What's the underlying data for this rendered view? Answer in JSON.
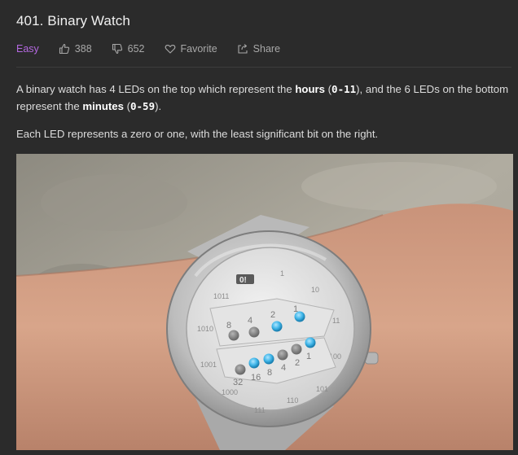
{
  "problem": {
    "title": "401. Binary Watch",
    "difficulty": "Easy",
    "likes": "388",
    "dislikes": "652",
    "favorite_label": "Favorite",
    "share_label": "Share"
  },
  "description": {
    "p1_before_hours": "A binary watch has 4 LEDs on the top which represent the ",
    "hours_word": "hours",
    "hours_open": " (",
    "hours_range": "0-11",
    "mid_text": "), and the 6 LEDs on the bottom represent the ",
    "minutes_word": "minutes",
    "minutes_open": " (",
    "minutes_range": "0-59",
    "p1_end": ").",
    "p2": "Each LED represents a zero or one, with the least significant bit on the right."
  },
  "watch_face": {
    "hour_labels": [
      "8",
      "4",
      "2",
      "1"
    ],
    "minute_labels": [
      "32",
      "16",
      "8",
      "4",
      "2",
      "1"
    ],
    "ring_labels": [
      "1011",
      "1010",
      "1001",
      "1000",
      "111",
      "110",
      "101",
      "100",
      "11",
      "10",
      "1"
    ],
    "brand_logo": "0!"
  },
  "colors": {
    "background": "#2b2b2b",
    "difficulty": "#b468e0",
    "muted_text": "#a8a8a8",
    "led_on": "#3fb5e8",
    "led_off": "#8a8a8a"
  },
  "icons": {
    "like": "thumbs-up-icon",
    "dislike": "thumbs-down-icon",
    "favorite": "heart-icon",
    "share": "share-icon"
  }
}
